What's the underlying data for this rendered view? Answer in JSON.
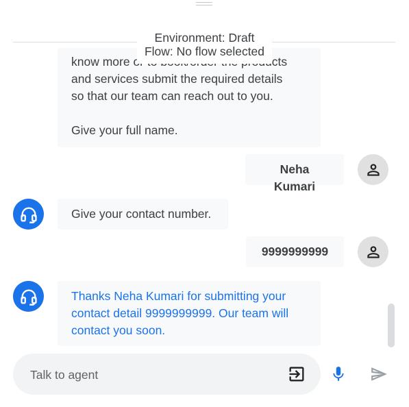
{
  "header": {
    "environment": "Environment: Draft",
    "flow": "Flow: No flow selected"
  },
  "messages": [
    {
      "role": "agent",
      "lines": [
        "know more or to book/order the products",
        "and services submit the required details",
        "so that our team can reach out to you.",
        "",
        "Give your full name."
      ]
    },
    {
      "role": "user",
      "text": "Neha Kumari"
    },
    {
      "role": "agent",
      "text": "Give your contact number."
    },
    {
      "role": "user",
      "text": "9999999999"
    },
    {
      "role": "agent",
      "lines": [
        "Thanks Neha Kumari for submitting your",
        "contact detail 9999999999. Our team will",
        "contact you soon."
      ]
    }
  ],
  "input": {
    "placeholder": "Talk to agent",
    "value": ""
  },
  "icons": {
    "agent_avatar": "headset-icon",
    "user_avatar": "person-icon",
    "escalate": "exit-to-app-icon",
    "mic": "mic-icon",
    "send": "send-icon"
  },
  "colors": {
    "accent": "#1a73e8",
    "bubble_bg": "#f8f9fa",
    "user_avatar_bg": "#e0e0e0",
    "input_bg": "#f1f3f4"
  }
}
